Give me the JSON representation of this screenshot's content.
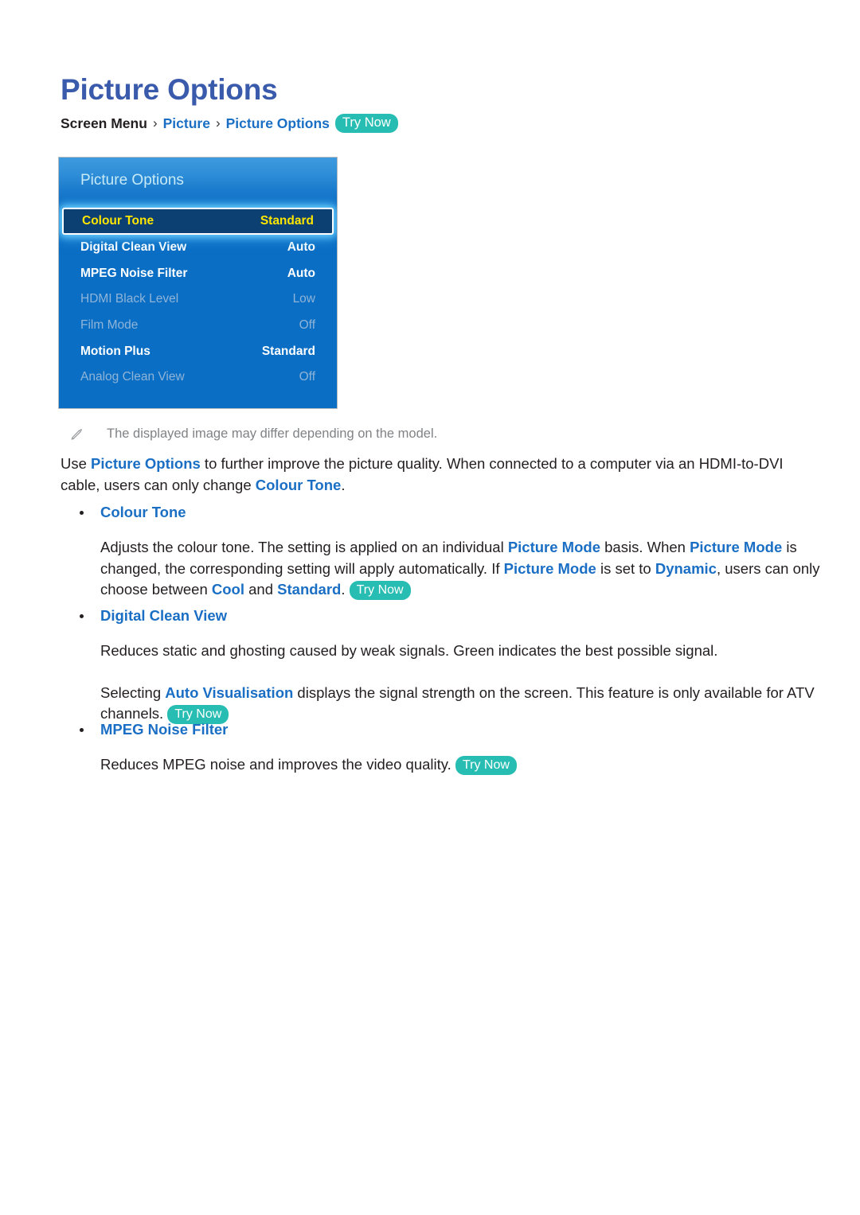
{
  "page": {
    "title": "Picture Options"
  },
  "breadcrumb": {
    "root": "Screen Menu",
    "sep": "›",
    "level1": "Picture",
    "level2": "Picture Options",
    "try_now": "Try Now"
  },
  "tv_menu": {
    "header_title": "Picture Options",
    "rows": [
      {
        "label": "Colour Tone",
        "value": "Standard",
        "state": "selected"
      },
      {
        "label": "Digital Clean View",
        "value": "Auto",
        "state": "enabled"
      },
      {
        "label": "MPEG Noise Filter",
        "value": "Auto",
        "state": "enabled"
      },
      {
        "label": "HDMI Black Level",
        "value": "Low",
        "state": "disabled"
      },
      {
        "label": "Film Mode",
        "value": "Off",
        "state": "disabled"
      },
      {
        "label": "Motion Plus",
        "value": "Standard",
        "state": "enabled"
      },
      {
        "label": "Analog Clean View",
        "value": "Off",
        "state": "disabled"
      }
    ]
  },
  "note": {
    "icon": "pencil-icon",
    "text": "The displayed image may differ depending on the model."
  },
  "lead": {
    "t1": "Use ",
    "l1": "Picture Options",
    "t2": " to further improve the picture quality. When connected to a computer via an HDMI-to-DVI cable, users can only change ",
    "l2": "Colour Tone",
    "t3": "."
  },
  "sections": [
    {
      "heading": "Colour Tone",
      "paragraphs": [
        {
          "t1": "Adjusts the colour tone. The setting is applied on an individual ",
          "l1": "Picture Mode",
          "t2": " basis. When ",
          "l2": "Picture Mode",
          "t3": " is changed, the corresponding setting will apply automatically. If ",
          "l3": "Picture Mode",
          "t4": " is set to ",
          "l4": "Dynamic",
          "t5": ", users can only choose between ",
          "l5": "Cool",
          "t6": " and ",
          "l6": "Standard",
          "t7": ". ",
          "badge": "Try Now"
        }
      ]
    },
    {
      "heading": "Digital Clean View",
      "paragraphs": [
        {
          "t1": "Reduces static and ghosting caused by weak signals. Green indicates the best possible signal."
        },
        {
          "t1": "Selecting ",
          "l1": "Auto Visualisation",
          "t2": " displays the signal strength on the screen. This feature is only available for ATV channels. ",
          "badge": "Try Now"
        }
      ]
    },
    {
      "heading": "MPEG Noise Filter",
      "paragraphs": [
        {
          "t1": "Reduces MPEG noise and improves the video quality. ",
          "badge": "Try Now"
        }
      ]
    }
  ],
  "colors": {
    "title_blue": "#3a5aab",
    "link_blue": "#1a6fc4",
    "badge_teal": "#27bdb2",
    "panel_blue": "#0a6ec4",
    "selected_row_bg": "#0c3f72",
    "selected_row_text": "#ffe600",
    "disabled_text": "#8fb4d8",
    "note_gray": "#808285"
  }
}
